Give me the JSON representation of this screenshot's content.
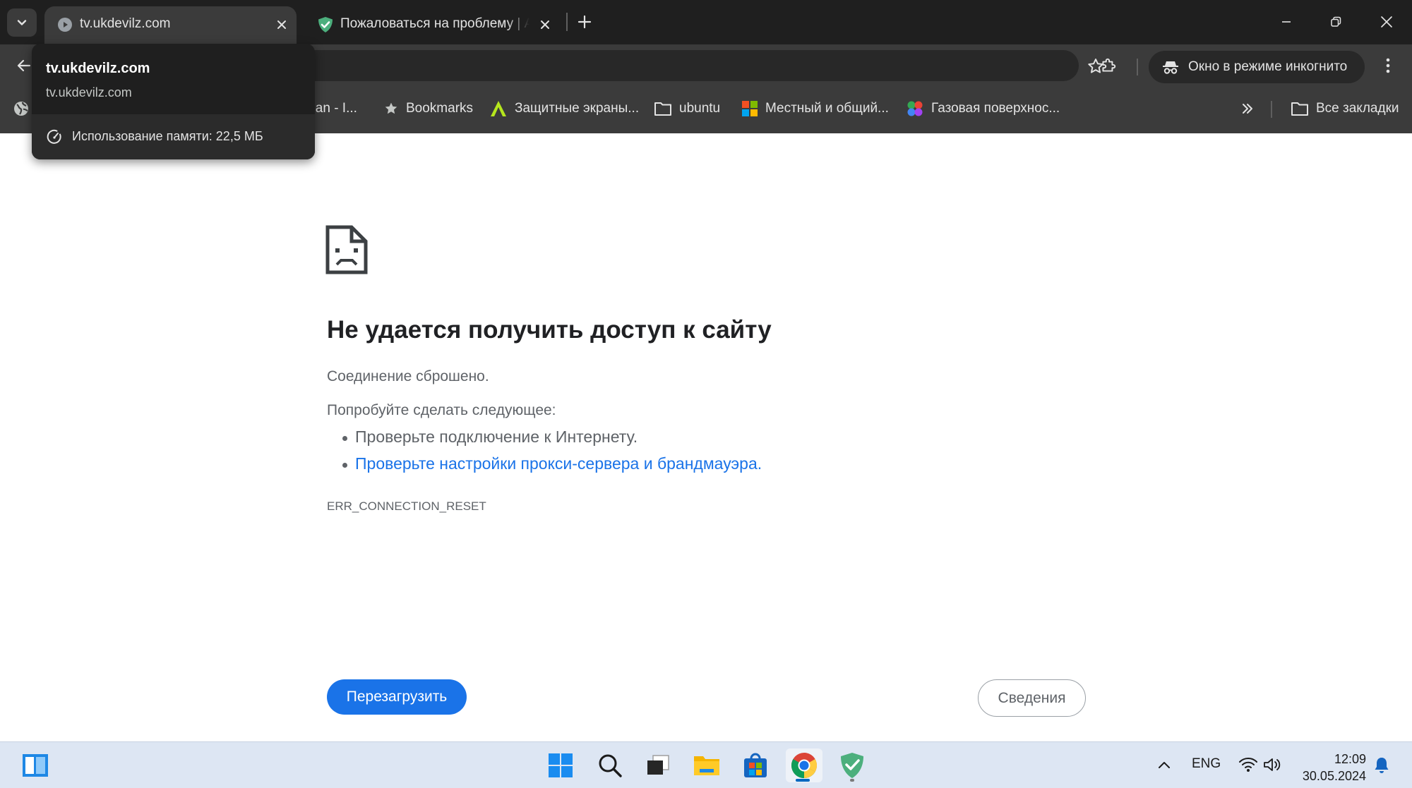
{
  "browser": {
    "tabs": [
      {
        "title": "tv.ukdevilz.com",
        "active": true,
        "favicon": "play-circle-icon"
      },
      {
        "title": "Пожаловаться на проблему | Aı",
        "active": false,
        "favicon": "shield-check-icon"
      }
    ],
    "incognito_label": "Окно в режиме инкогнито",
    "bookmarks": [
      {
        "label": "lban - I...",
        "icon": "globe-icon"
      },
      {
        "label": "Bookmarks",
        "icon": "star-icon"
      },
      {
        "label": "Защитные экраны...",
        "icon": "a-logo-icon"
      },
      {
        "label": "ubuntu",
        "icon": "folder-icon"
      },
      {
        "label": "Местный и общий...",
        "icon": "colored-squares-icon"
      },
      {
        "label": "Газовая поверхнос...",
        "icon": "colored-dots-icon"
      }
    ],
    "all_bookmarks_label": "Все закладки"
  },
  "hovercard": {
    "title": "tv.ukdevilz.com",
    "domain": "tv.ukdevilz.com",
    "memory": "Использование памяти: 22,5 МБ"
  },
  "error_page": {
    "title": "Не удается получить доступ к сайту",
    "subtitle": "Соединение сброшено.",
    "try_label": "Попробуйте сделать следующее:",
    "suggestions": [
      {
        "text": "Проверьте подключение к Интернету.",
        "link": false
      },
      {
        "text": "Проверьте настройки прокси-сервера и брандмауэра.",
        "link": true
      }
    ],
    "error_code": "ERR_CONNECTION_RESET",
    "reload_label": "Перезагрузить",
    "details_label": "Сведения"
  },
  "taskbar": {
    "apps": [
      "widgets-icon",
      "start-icon",
      "search-icon",
      "task-view-icon",
      "file-explorer-icon",
      "store-icon",
      "chrome-icon",
      "adguard-icon"
    ],
    "language": "ENG",
    "time": "12:09",
    "date": "30.05.2024"
  },
  "colors": {
    "accent": "#1a73e8",
    "chrome_dark": "#1f1f1f",
    "toolbar": "#3b3b3b",
    "taskbar": "#dde6f3"
  }
}
